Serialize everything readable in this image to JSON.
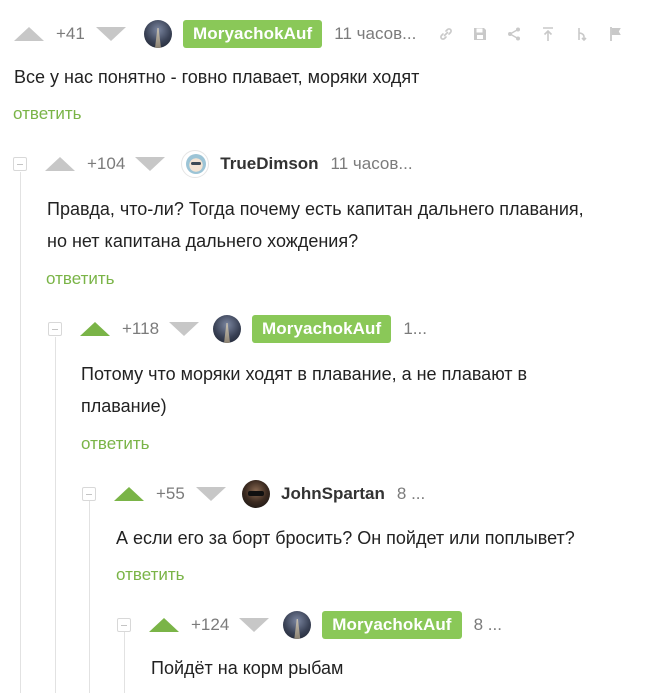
{
  "comments": [
    {
      "rating": "+41",
      "author": "MoryachokAuf",
      "time": "11 часов...",
      "text": "Все у нас понятно - говно плавает, моряки ходят",
      "reply": "ответить"
    },
    {
      "rating": "+104",
      "author": "TrueDimson",
      "time": "11 часов...",
      "text": "Правда, что-ли? Тогда почему есть капитан дальнего плавания, но нет капитана дальнего хождения?",
      "reply": "ответить"
    },
    {
      "rating": "+118",
      "author": "MoryachokAuf",
      "time": "1...",
      "text": "Потому что моряки ходят в плавание, а не плавают в плавание)",
      "reply": "ответить"
    },
    {
      "rating": "+55",
      "author": "JohnSpartan",
      "time": "8 ...",
      "text": "А если его за борт бросить? Он пойдет или поплывет?",
      "reply": "ответить"
    },
    {
      "rating": "+124",
      "author": "MoryachokAuf",
      "time": "8 ...",
      "text": "Пойдёт на корм рыбам"
    }
  ],
  "toolbar_icons": [
    "link-icon",
    "save-icon",
    "share-icon",
    "arrow-up-icon",
    "branch-icon",
    "flag-icon"
  ],
  "colors": {
    "accent": "#8ac858",
    "upvoted": "#7ab447",
    "muted": "#7b7b7b"
  }
}
